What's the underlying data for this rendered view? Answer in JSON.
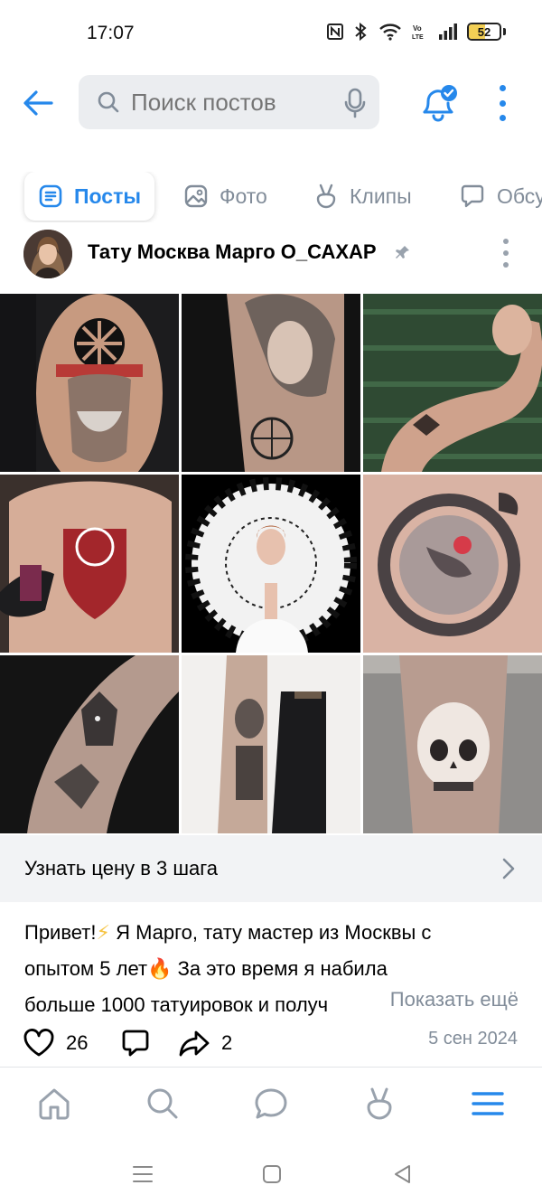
{
  "status_bar": {
    "time": "17:07",
    "battery": "52",
    "battery_level": 0.52,
    "network_label": "Vo LTE"
  },
  "header": {
    "search_placeholder": "Поиск постов"
  },
  "tabs": [
    {
      "label": "Посты",
      "icon": "posts-icon",
      "active": true
    },
    {
      "label": "Фото",
      "icon": "photo-icon",
      "active": false
    },
    {
      "label": "Клипы",
      "icon": "clips-icon",
      "active": false
    },
    {
      "label": "Обсу",
      "icon": "discussions-icon",
      "active": false
    }
  ],
  "post": {
    "author": "Тату Москва Марго О_САХАР",
    "photos": [
      {
        "name": "photo-tattoo-slavic-sun-shoulder"
      },
      {
        "name": "photo-tattoo-woman-portrait-arm"
      },
      {
        "name": "photo-tattoo-arm-green-background"
      },
      {
        "name": "photo-tattoo-back-shield"
      },
      {
        "name": "photo-woman-rune-circle"
      },
      {
        "name": "photo-tattoo-serpent-circle"
      },
      {
        "name": "photo-tattoo-wolf-sleeve"
      },
      {
        "name": "photo-tattoo-valkyrie-forearm"
      },
      {
        "name": "photo-tattoo-skull-leg"
      }
    ],
    "price_link": "Узнать цену в 3 шага",
    "text_line1": "Привет!",
    "text_line1b": "Я Марго, тату мастер из Москвы с",
    "text_line2": "опытом 5 лет",
    "text_line2b": "За это время я набила",
    "text_line3": "больше 1000 татуировок и получ",
    "emoji_lightning": "⚡",
    "emoji_fire": "🔥",
    "show_more": "Показать ещё",
    "likes": "26",
    "shares": "2",
    "date": "5 сен 2024"
  },
  "colors": {
    "accent": "#2688eb",
    "secondary_text": "#818c99",
    "search_bg": "#ebedf0",
    "link_bg": "#f2f3f5"
  },
  "bottom_nav": [
    "home-icon",
    "search-icon",
    "messages-icon",
    "clips-icon",
    "menu-icon"
  ]
}
